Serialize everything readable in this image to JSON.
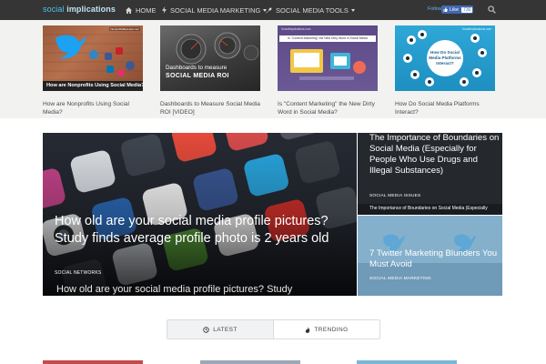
{
  "header": {
    "logo_prefix": "social",
    "logo_suffix": "implications",
    "nav": [
      {
        "label": "HOME",
        "icon": "home-icon"
      },
      {
        "label": "SOCIAL MEDIA MARKETING",
        "icon": "bolt-icon"
      },
      {
        "label": "SOCIAL MEDIA TOOLS",
        "icon": "wrench-icon"
      }
    ],
    "follow_label": "Follow",
    "like_label": "Like",
    "like_count": "730",
    "search_icon": "search-icon"
  },
  "featured": [
    {
      "title": "How are Nonprofits Using Social Media?",
      "overlay": "How are Nonprofits Using Social Media?",
      "badge": "NonprofitsBeeHelp.com"
    },
    {
      "title": "Dashboards to Measure Social Media ROI [VIDEO]",
      "overlay_line1": "Dashboards to measure",
      "overlay_line2": "SOCIAL MEDIA ROI"
    },
    {
      "title": "Is \"Content Marketing\" the New Dirty Word in Social Media?",
      "overlay": "Is \"Content Marketing\" the New Dirty Word in Social Media",
      "badge": "SocialImplications.com"
    },
    {
      "title": "How Do Social Media Platforms Interact?",
      "overlay_lines": [
        "How Do Social",
        "Media Platforms",
        "Interact?"
      ],
      "badge": "SocialImplications.com"
    }
  ],
  "hero": {
    "title": "How old are your social media profile pictures? Study finds average profile photo is 2 years old",
    "category": "SOCIAL NETWORKS",
    "caption": "How old are your social media profile pictures? Study"
  },
  "side": [
    {
      "title": "The Importance of Boundaries on Social Media (Especially for People Who Use Drugs and Illegal Substances)",
      "category": "SOCIAL MEDIA ISSUES",
      "caption": "The Importance of Boundaries on Social Media (Especially"
    },
    {
      "title": "7 Twitter Marketing Blunders You Must Avoid",
      "category": "SOCIAL MEDIA MARKETING"
    }
  ],
  "tabs": [
    {
      "label": "LATEST",
      "icon": "clock-icon"
    },
    {
      "label": "TRENDING",
      "icon": "flame-icon"
    }
  ],
  "colors": {
    "topbar": "#353535",
    "strip": "#f2f3f1",
    "accent": "#4fc1e9"
  }
}
